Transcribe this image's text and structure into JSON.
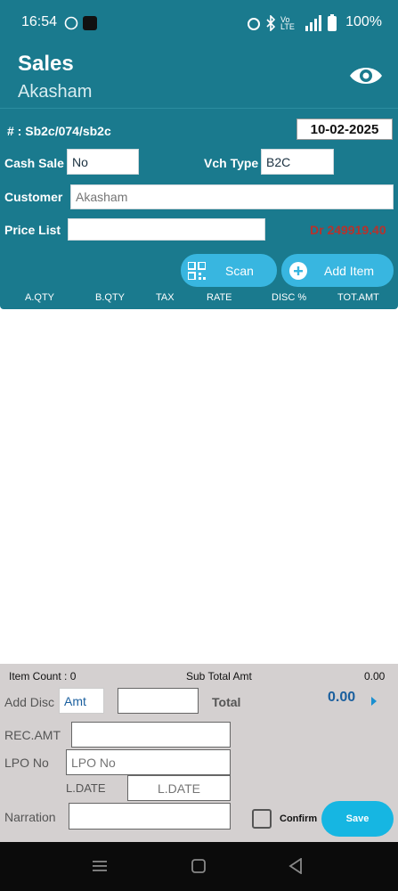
{
  "status": {
    "time": "16:54",
    "battery": "100%"
  },
  "header": {
    "title": "Sales",
    "subtitle": "Akasham"
  },
  "voucher": {
    "number": "# : Sb2c/074/sb2c",
    "date": "10-02-2025"
  },
  "form": {
    "cash_sale_label": "Cash Sale",
    "cash_sale_value": "No",
    "vch_type_label": "Vch Type",
    "vch_type_value": "B2C",
    "customer_label": "Customer",
    "customer_placeholder": "Akasham",
    "price_list_label": "Price List",
    "price_list_value": "",
    "balance": "Dr 249919.40"
  },
  "actions": {
    "scan_label": "Scan",
    "add_item_label": "Add Item"
  },
  "columns": [
    "A.QTY",
    "B.QTY",
    "TAX",
    "RATE",
    "DISC %",
    "TOT.AMT"
  ],
  "summary": {
    "item_count": "Item Count : 0",
    "sub_total_label": "Sub Total Amt",
    "sub_total_value": "0.00",
    "add_disc_label": "Add Disc",
    "add_disc_type": "Amt",
    "add_disc_value": "",
    "total_label": "Total",
    "total_value": "0.00",
    "rec_amt_label": "REC.AMT",
    "rec_amt_value": "",
    "lpo_label": "LPO No",
    "lpo_placeholder": "LPO No",
    "ldate_label": "L.DATE",
    "ldate_placeholder": "L.DATE",
    "narration_label": "Narration",
    "narration_value": "",
    "confirm_label": "Confirm",
    "save_label": "Save"
  },
  "colors": {
    "teal": "#1a7a8e",
    "accent": "#38b6e0",
    "balance_red": "#b7322c",
    "total_blue": "#1a5f9e"
  }
}
